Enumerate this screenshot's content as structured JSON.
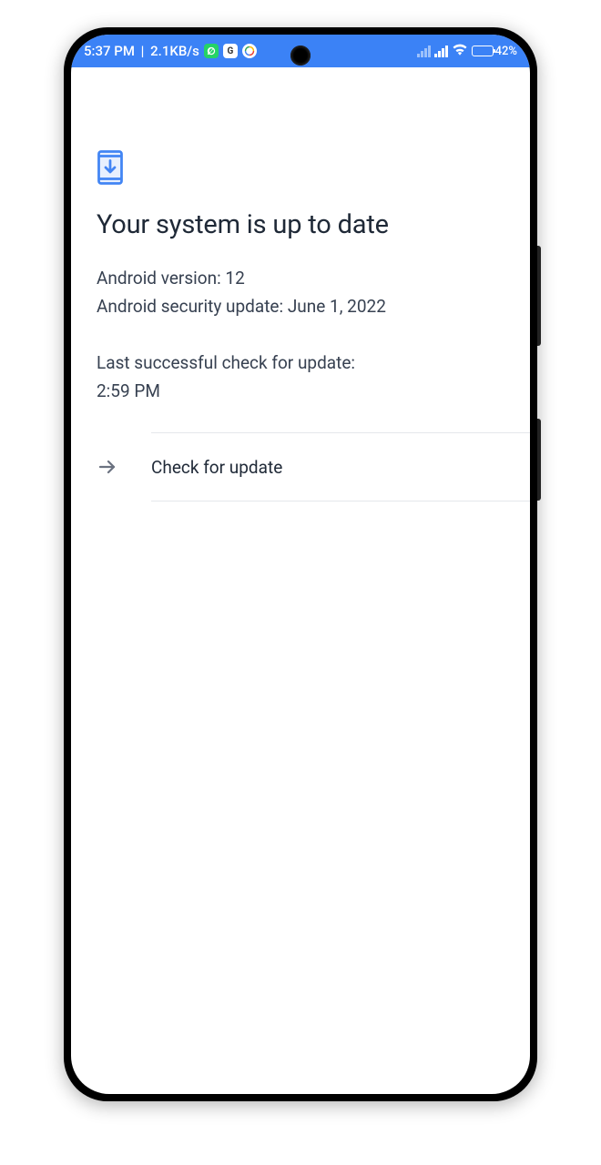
{
  "status_bar": {
    "time": "5:37 PM",
    "data_rate": "2.1KB/s",
    "battery_pct": "42%"
  },
  "main": {
    "title": "Your system is up to date",
    "android_version_line": "Android version: 12",
    "security_update_line": "Android security update: June 1, 2022",
    "last_check_label": "Last successful check for update:",
    "last_check_time": "2:59 PM"
  },
  "actions": {
    "check_update_label": "Check for update"
  }
}
